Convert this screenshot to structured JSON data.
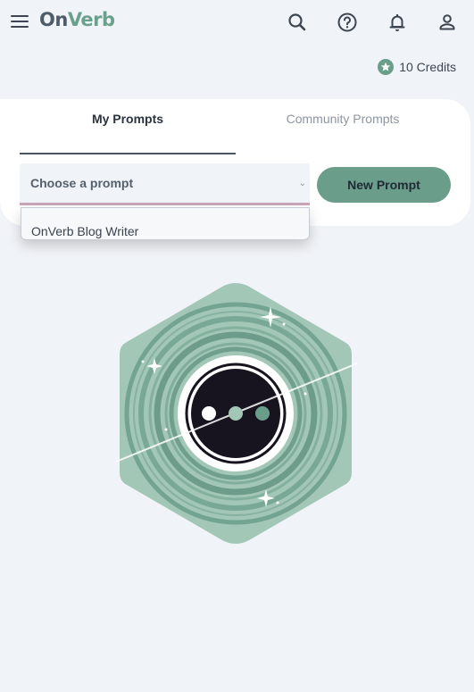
{
  "header": {
    "logo_on": "On",
    "logo_verb": "Verb",
    "icons": [
      "menu-icon",
      "search-icon",
      "help-icon",
      "bell-icon",
      "user-icon"
    ]
  },
  "credits": {
    "label": "10 Credits",
    "icon": "star-icon"
  },
  "tabs": [
    {
      "label": "My Prompts",
      "active": true
    },
    {
      "label": "Community Prompts",
      "active": false
    }
  ],
  "prompt_select": {
    "placeholder": "Choose a prompt",
    "options": [
      "OnVerb Blog Writer"
    ]
  },
  "new_prompt_label": "New Prompt",
  "colors": {
    "accent": "#6b9d8b",
    "hex_light": "#a3c7b6",
    "background": "#f0f3f7",
    "dark": "#17141f"
  }
}
